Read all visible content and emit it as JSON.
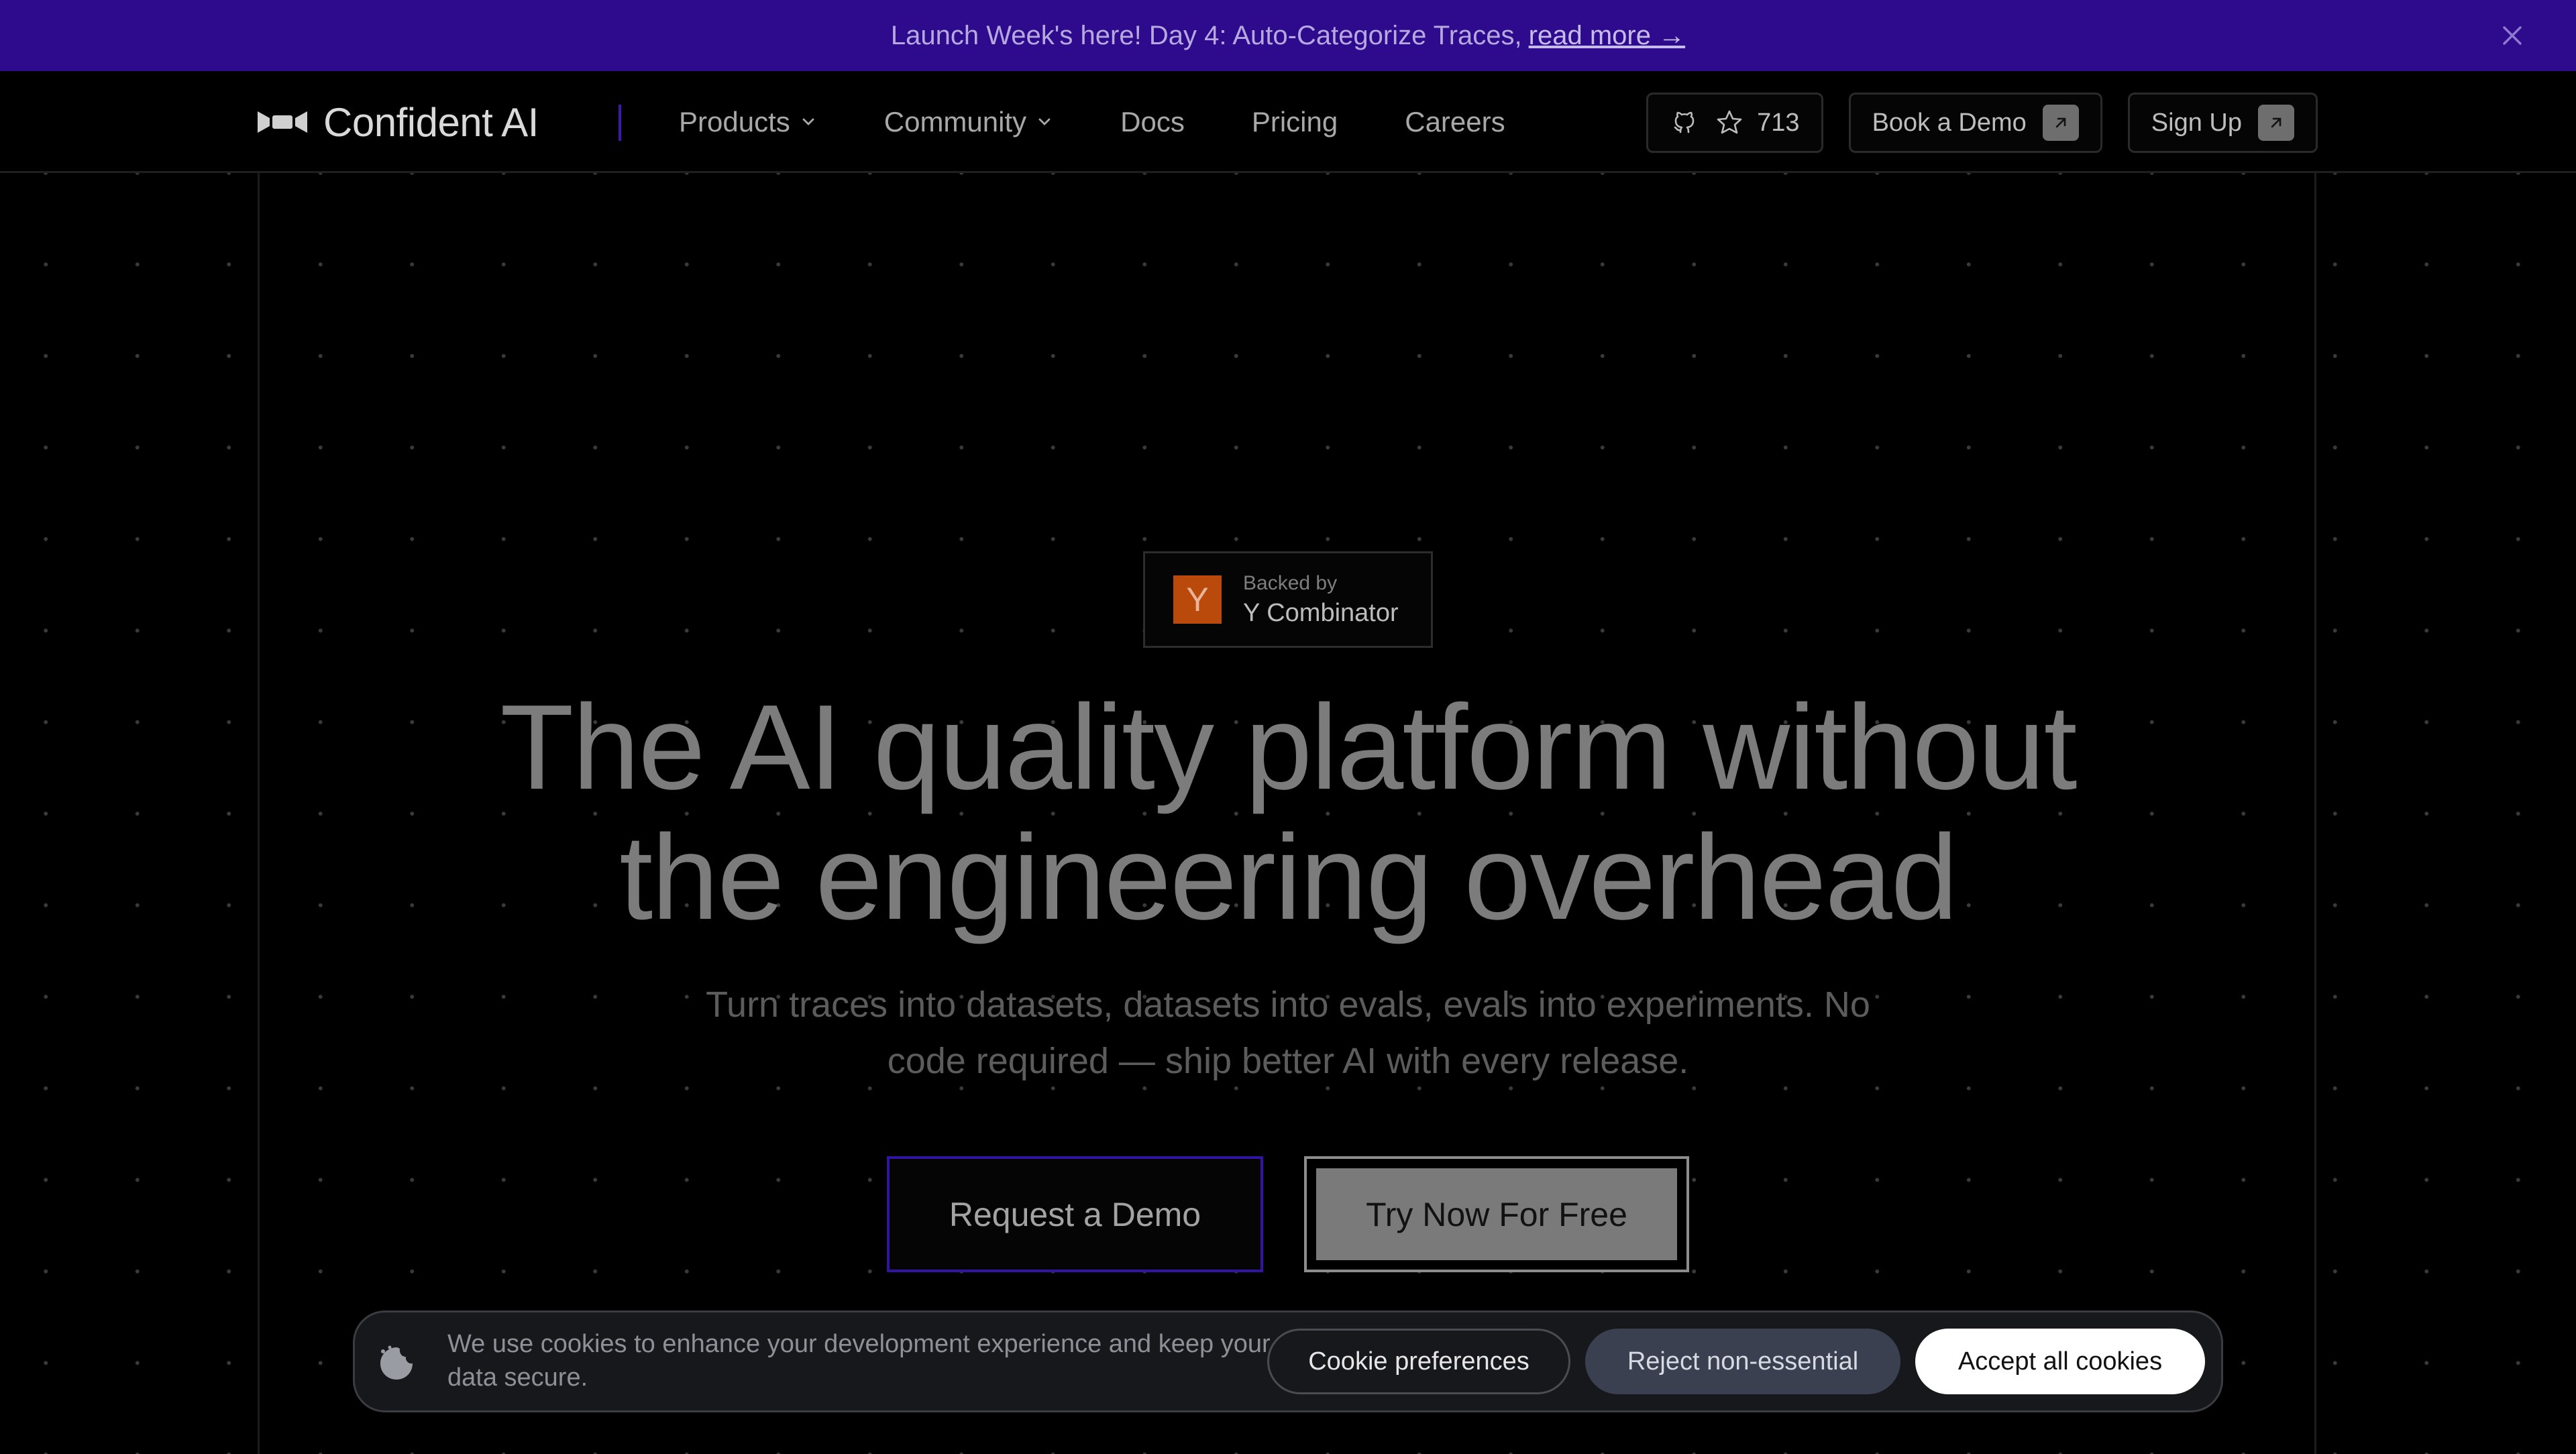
{
  "announcement": {
    "text": "Launch Week's here! Day 4: Auto-Categorize Traces,",
    "link": "read more →",
    "close_icon": "close-icon"
  },
  "nav": {
    "logo_text": "Confident AI",
    "links": [
      {
        "label": "Products",
        "has_dropdown": true
      },
      {
        "label": "Community",
        "has_dropdown": true
      },
      {
        "label": "Docs",
        "has_dropdown": false
      },
      {
        "label": "Pricing",
        "has_dropdown": false
      },
      {
        "label": "Careers",
        "has_dropdown": false
      }
    ],
    "github_stars": "713",
    "book_demo": "Book a Demo",
    "sign_up": "Sign Up"
  },
  "badge": {
    "logo_letter": "Y",
    "small": "Backed by",
    "big": "Y Combinator"
  },
  "hero": {
    "title_line1": "The AI quality platform without",
    "title_line2": "the engineering overhead",
    "subtitle_line1": "Turn traces into datasets, datasets into evals, evals into experiments. No",
    "subtitle_line2": "code required — ship better AI with every release.",
    "cta_demo": "Request a Demo",
    "cta_try": "Try Now For Free"
  },
  "cookie": {
    "text": "We use cookies to enhance your development experience and keep your data secure.",
    "preferences": "Cookie preferences",
    "reject": "Reject non-essential",
    "accept": "Accept all cookies"
  },
  "colors": {
    "announce_bg": "#2e0a8c",
    "accent_purple": "#3214a3",
    "yc_orange": "#b94a0c"
  }
}
